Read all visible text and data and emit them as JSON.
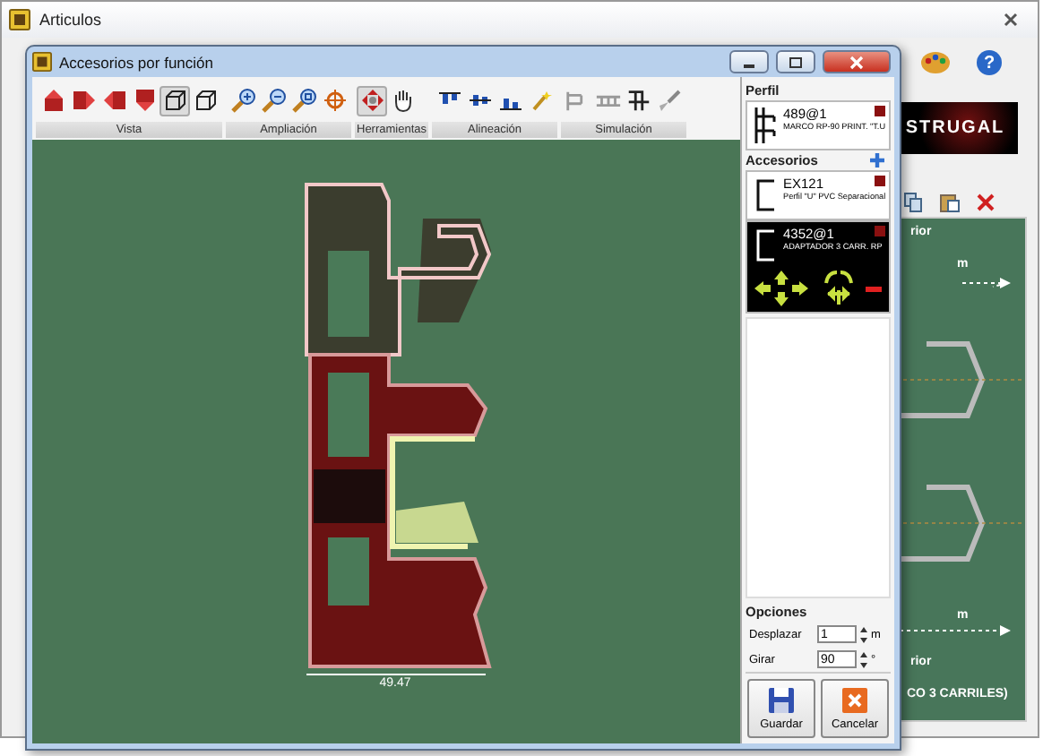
{
  "background_window": {
    "title": "Articulos",
    "logo_text": "STRUGAL",
    "help_glyph": "?",
    "panel_texts": [
      "rior",
      "m",
      "m",
      "rior",
      "CO 3 CARRILES)"
    ]
  },
  "dialog": {
    "title": "Accesorios por función",
    "toolbar_groups": [
      {
        "label": "Vista",
        "tools": [
          {
            "kind": "view-up",
            "selected": false
          },
          {
            "kind": "view-right",
            "selected": false
          },
          {
            "kind": "view-left",
            "selected": false
          },
          {
            "kind": "view-down",
            "selected": false
          },
          {
            "kind": "wire-cube",
            "selected": true
          },
          {
            "kind": "cube",
            "selected": false
          }
        ]
      },
      {
        "label": "Ampliación",
        "tools": [
          {
            "kind": "zoom-in",
            "selected": false
          },
          {
            "kind": "zoom-out",
            "selected": false
          },
          {
            "kind": "zoom-fit",
            "selected": false
          },
          {
            "kind": "target",
            "selected": false
          }
        ]
      },
      {
        "label": "Herramientas",
        "tools": [
          {
            "kind": "move",
            "selected": true
          },
          {
            "kind": "hand",
            "selected": false
          }
        ]
      },
      {
        "label": "Alineación",
        "tools": [
          {
            "kind": "align-top",
            "selected": false
          },
          {
            "kind": "align-middle",
            "selected": false
          },
          {
            "kind": "align-bottom",
            "selected": false
          },
          {
            "kind": "wand",
            "selected": false
          }
        ]
      },
      {
        "label": "Simulación",
        "tools": [
          {
            "kind": "sim-grid",
            "selected": false
          },
          {
            "kind": "sim-rail",
            "selected": false
          },
          {
            "kind": "sim-frame",
            "selected": false
          },
          {
            "kind": "brush",
            "selected": false
          }
        ]
      }
    ],
    "canvas": {
      "dimension": "49.47"
    },
    "side_panel": {
      "profile_header": "Perfil",
      "profile": {
        "code": "489@1",
        "description": "MARCO RP-90 PRINT. \"T.U"
      },
      "accessories_header": "Accesorios",
      "accessories": [
        {
          "code": "EX121",
          "description": "Perfil \"U\" PVC Separacional",
          "selected": false
        },
        {
          "code": "4352@1",
          "description": "ADAPTADOR 3 CARR. RP",
          "selected": true
        }
      ],
      "options_header": "Opciones",
      "options": [
        {
          "label": "Desplazar",
          "value": "1",
          "unit": "m"
        },
        {
          "label": "Girar",
          "value": "90",
          "unit": "°"
        }
      ]
    },
    "buttons": [
      {
        "kind": "save",
        "label": "Guardar"
      },
      {
        "kind": "cancel",
        "label": "Cancelar"
      }
    ]
  }
}
